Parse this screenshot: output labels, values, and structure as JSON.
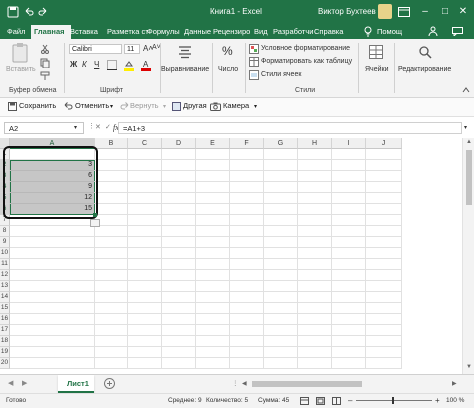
{
  "titlebar": {
    "workbook_title": "Книга1 - Excel",
    "user_name": "Виктор Бухтеев",
    "help_label": "Помощ"
  },
  "tabs": [
    "Файл",
    "Главная",
    "Вставка",
    "Разметка ст",
    "Формулы",
    "Данные",
    "Рецензиро",
    "Вид",
    "Разработчи",
    "Справка"
  ],
  "active_tab": "Главная",
  "ribbon": {
    "clipboard": {
      "paste_label": "Вставить",
      "group_label": "Буфер обмена"
    },
    "font": {
      "font_name": "Calibri",
      "font_size": "11",
      "group_label": "Шрифт"
    },
    "alignment": {
      "label": "Выравнивание"
    },
    "number": {
      "label": "Число"
    },
    "styles": {
      "conditional_formatting": "Условное форматирование",
      "format_as_table": "Форматировать как таблицу",
      "cell_styles": "Стили ячеек",
      "group_label": "Стили"
    },
    "cells": {
      "label": "Ячейки"
    },
    "editing": {
      "label": "Редактирование"
    }
  },
  "quick_toolbar": {
    "save": "Сохранить",
    "undo": "Отменить",
    "redo": "Вернуть",
    "other": "Другая",
    "camera": "Камера"
  },
  "formula_bar": {
    "name_box": "A2",
    "fx": "fx",
    "formula": "=A1+3"
  },
  "columns": [
    "A",
    "B",
    "C",
    "D",
    "E",
    "F",
    "G",
    "H",
    "I",
    "J"
  ],
  "rows": [
    "1",
    "2",
    "3",
    "4",
    "5",
    "6",
    "7",
    "8",
    "9",
    "10",
    "11",
    "12",
    "13",
    "14",
    "15",
    "16",
    "17",
    "18",
    "19",
    "20"
  ],
  "cell_values": [
    "3",
    "6",
    "9",
    "12",
    "15"
  ],
  "sheet_tabs": {
    "active_sheet": "Лист1"
  },
  "status": {
    "ready": "Готово",
    "average": "Среднее: 9",
    "count": "Количество: 5",
    "sum": "Сумма: 45",
    "zoom": "100 %"
  },
  "colors": {
    "accent": "#217346",
    "selection": "#c6c6c6",
    "grid": "#e1e1e1"
  }
}
